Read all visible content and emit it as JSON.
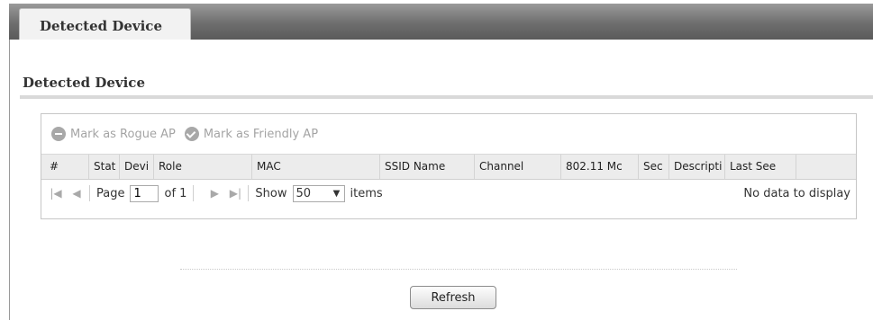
{
  "tab": {
    "label": "Detected Device"
  },
  "section": {
    "title": "Detected Device"
  },
  "toolbar": {
    "mark_rogue": "Mark as Rogue AP",
    "mark_friendly": "Mark as Friendly AP"
  },
  "table": {
    "columns": [
      "#",
      "Stat",
      "Devi",
      "Role",
      "MAC",
      "SSID Name",
      "Channel",
      "802.11 Mc",
      "Sec",
      "Descripti",
      "Last See"
    ]
  },
  "pager": {
    "page_label": "Page",
    "page_value": "1",
    "of_label": "of 1",
    "show_label": "Show",
    "show_value": "50",
    "items_label": "items",
    "empty_message": "No data to display"
  },
  "actions": {
    "refresh": "Refresh"
  }
}
